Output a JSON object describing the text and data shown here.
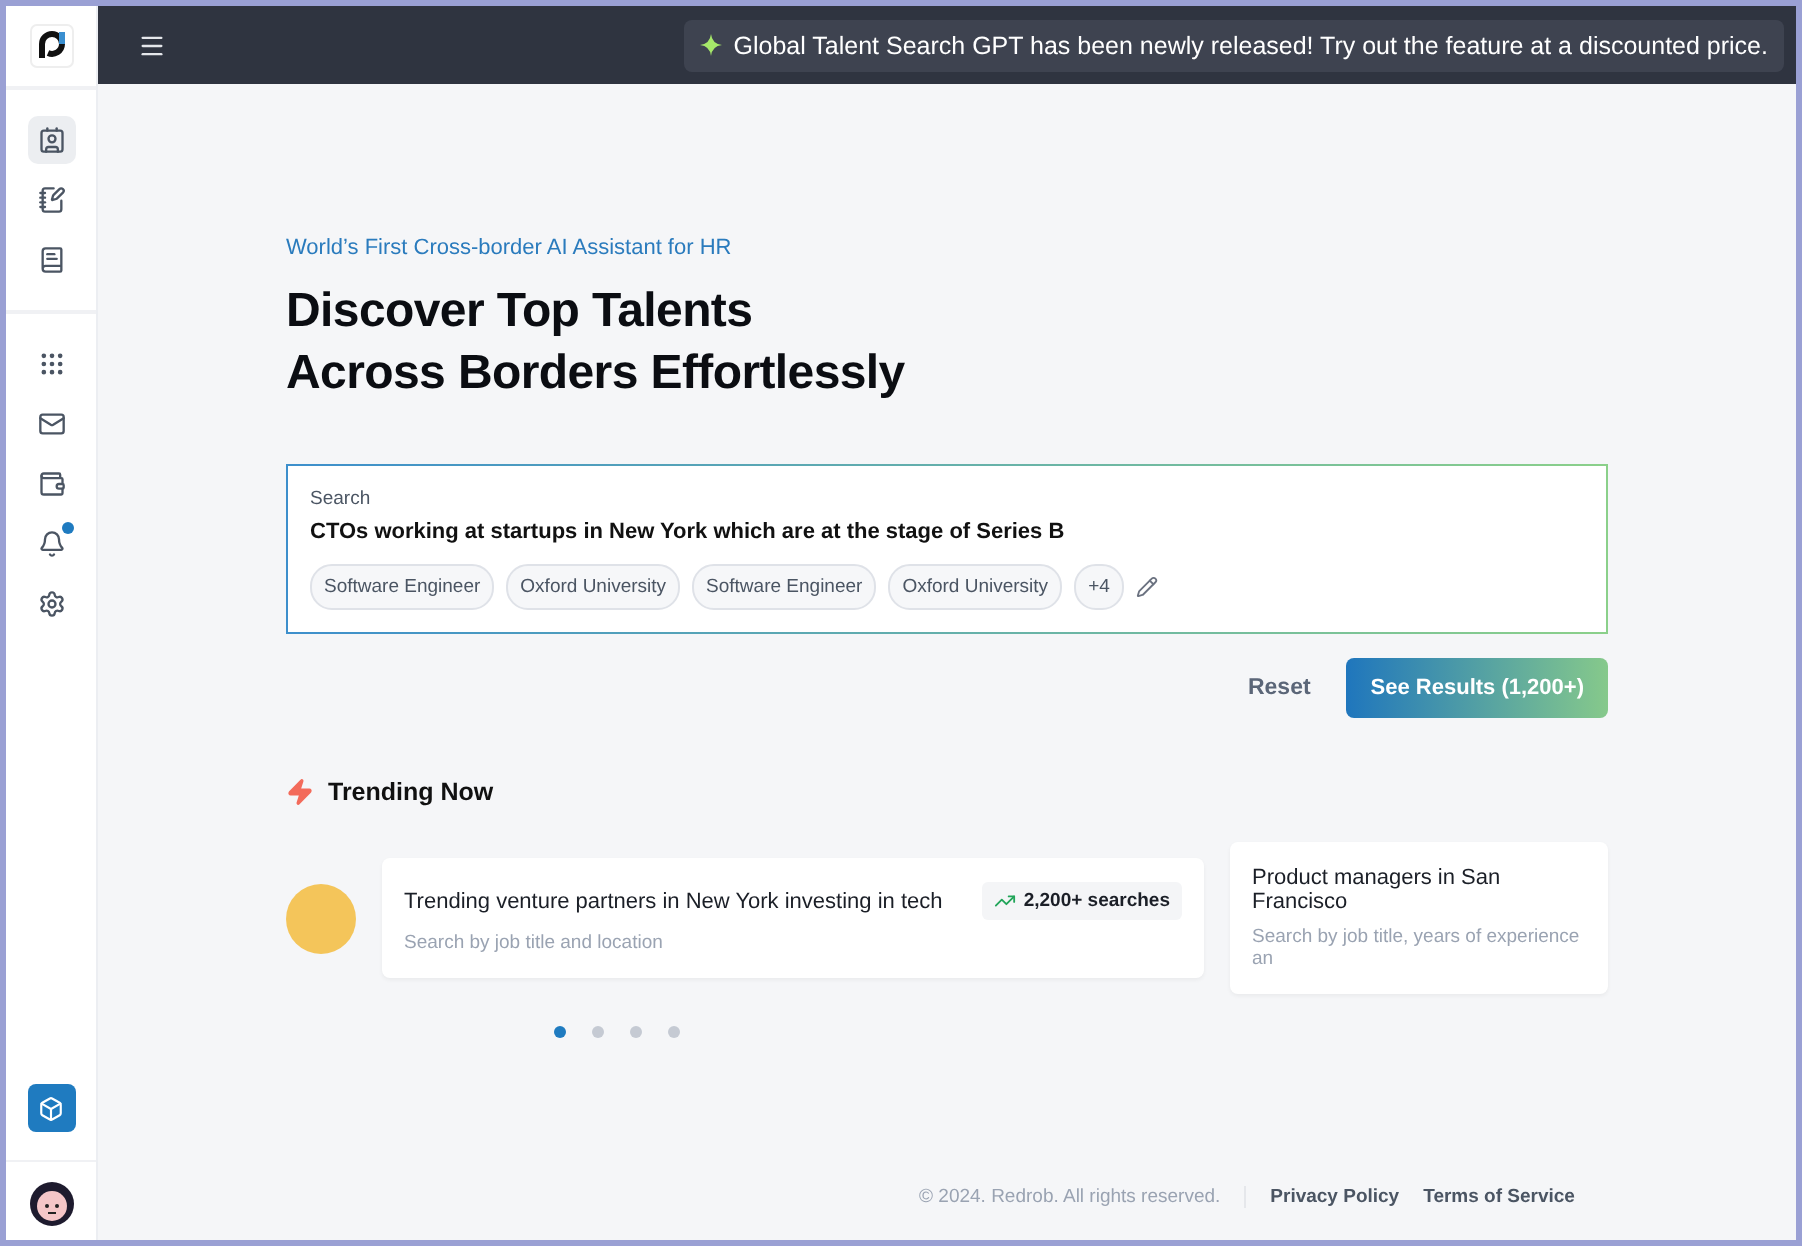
{
  "sidebar": {
    "top_items": [
      {
        "selected": true
      },
      {
        "selected": false
      },
      {
        "selected": false
      }
    ],
    "items": [
      {
        "selected": false,
        "badge": false
      },
      {
        "selected": false,
        "badge": false
      },
      {
        "selected": false,
        "badge": false
      },
      {
        "selected": false,
        "badge": true
      },
      {
        "selected": false,
        "badge": false
      }
    ]
  },
  "announcement": "Global Talent Search GPT has been newly released! Try out the feature at a discounted price.",
  "tagline": "World’s First Cross-border AI Assistant for HR",
  "title_lines": [
    "Discover Top Talents",
    "Across Borders Effortlessly"
  ],
  "search": {
    "label": "Search",
    "value": "CTOs working at startups in New York which are at the stage of Series B",
    "tags": [
      "Software Engineer",
      "Oxford University",
      "Software Engineer",
      "Oxford University"
    ],
    "more": "+4"
  },
  "actions": {
    "reset": "Reset",
    "see_results": "See Results (1,200+)"
  },
  "trending": {
    "title": "Trending Now",
    "cards": [
      {
        "title": "Trending venture partners in New York investing in tech",
        "subtitle": "Search by job title and location",
        "count": "2,200+ searches"
      },
      {
        "title": "Product managers in San Francisco",
        "subtitle": "Search by job title, years of experience an"
      }
    ],
    "dots": [
      {
        "selected": true
      },
      {
        "selected": false
      },
      {
        "selected": false
      },
      {
        "selected": false
      }
    ]
  },
  "footer": {
    "copyright": "© 2024. Redrob. All rights reserved.",
    "links": [
      "Privacy Policy",
      "Terms of Service"
    ]
  }
}
